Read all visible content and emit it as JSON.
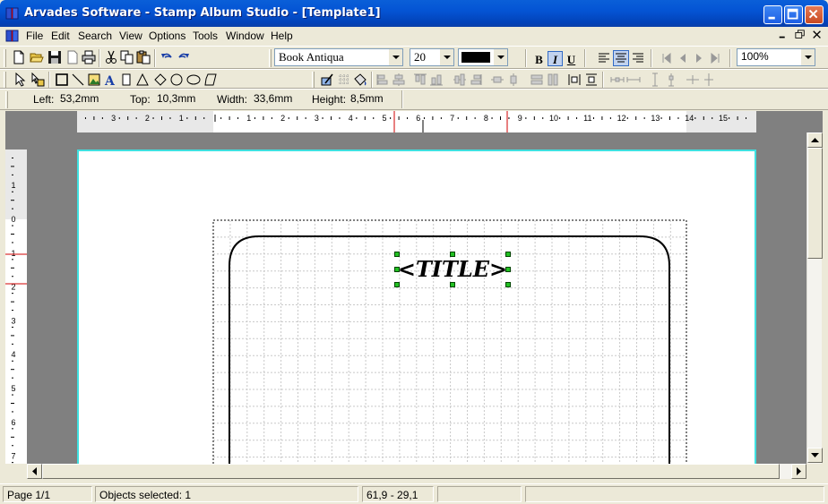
{
  "window": {
    "title": "Arvades Software - Stamp Album Studio - [Template1]"
  },
  "menu": {
    "items": [
      {
        "label": "File"
      },
      {
        "label": "Edit"
      },
      {
        "label": "Search"
      },
      {
        "label": "View"
      },
      {
        "label": "Options"
      },
      {
        "label": "Tools"
      },
      {
        "label": "Window"
      },
      {
        "label": "Help"
      }
    ]
  },
  "format_toolbar": {
    "font_name": "Book Antiqua",
    "font_size": "20",
    "color": "#000000",
    "bold_label": "B",
    "italic_label": "I",
    "underline_label": "U",
    "zoom": "100%"
  },
  "position_bar": {
    "left_label": "Left:",
    "left_value": "53,2mm",
    "top_label": "Top:",
    "top_value": "10,3mm",
    "width_label": "Width:",
    "width_value": "33,6mm",
    "height_label": "Height:",
    "height_value": "8,5mm"
  },
  "rulers": {
    "horizontal_labels": [
      "3",
      "2",
      "1",
      "1",
      "2",
      "3",
      "4",
      "5",
      "6",
      "7",
      "8",
      "9",
      "10",
      "11",
      "12",
      "13",
      "14",
      "15"
    ],
    "vertical_labels": [
      "1",
      "0",
      "1",
      "2",
      "3",
      "4",
      "5",
      "6",
      "7"
    ]
  },
  "canvas": {
    "title_placeholder": "<TITLE>",
    "page_border_color": "#40e0e0"
  },
  "statusbar": {
    "page": "Page 1/1",
    "selection": "Objects selected: 1",
    "cursor_coords": "61,9 - 29,1"
  }
}
